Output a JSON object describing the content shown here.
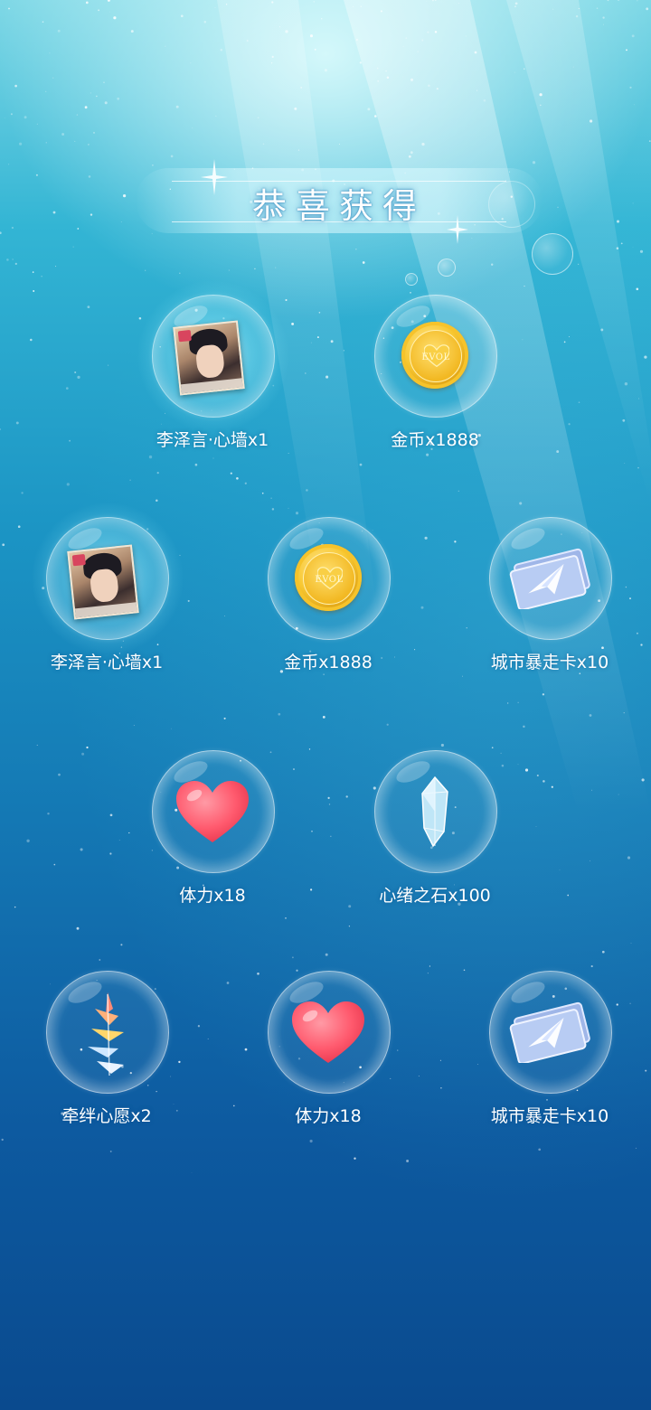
{
  "header": {
    "title": "恭喜获得"
  },
  "rewards": [
    {
      "label": "李泽言·心墙x1",
      "icon": "character-card-icon"
    },
    {
      "label": "金币x1888",
      "icon": "gold-coin-icon",
      "coin_text": "EVOL"
    },
    {
      "label": "李泽言·心墙x1",
      "icon": "character-card-icon"
    },
    {
      "label": "金币x1888",
      "icon": "gold-coin-icon",
      "coin_text": "EVOL"
    },
    {
      "label": "城市暴走卡x10",
      "icon": "ticket-icon"
    },
    {
      "label": "体力x18",
      "icon": "heart-icon"
    },
    {
      "label": "心绪之石x100",
      "icon": "crystal-icon"
    },
    {
      "label": "牵绊心愿x2",
      "icon": "paper-crane-icon"
    },
    {
      "label": "体力x18",
      "icon": "heart-icon"
    },
    {
      "label": "城市暴走卡x10",
      "icon": "ticket-icon"
    }
  ],
  "colors": {
    "bg_top": "#7fd8e6",
    "bg_bottom": "#0a4a8e",
    "coin": "#f8c832",
    "heart": "#ff5a6e"
  }
}
